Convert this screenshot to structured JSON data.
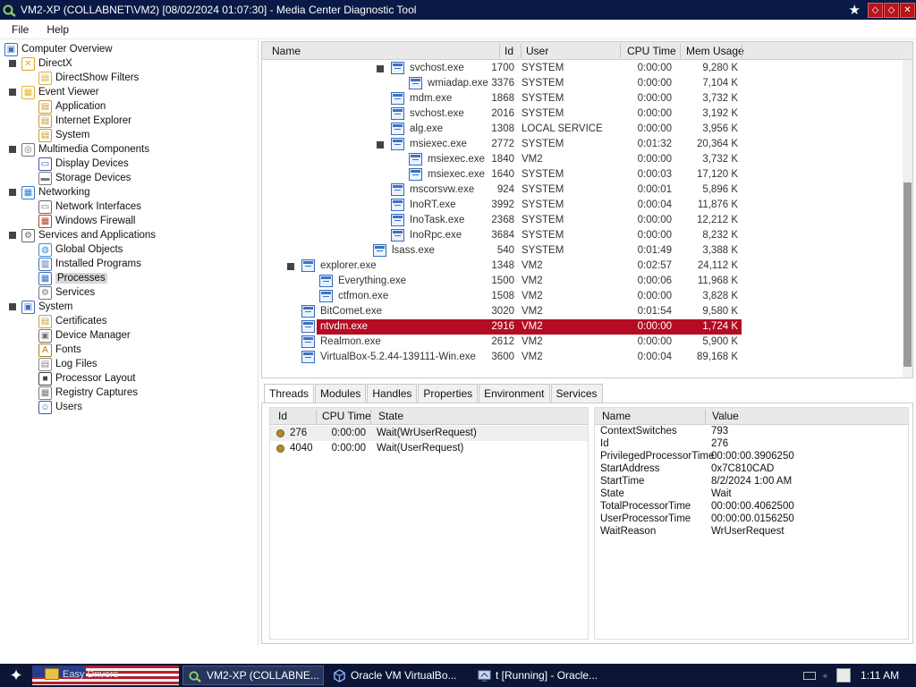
{
  "window": {
    "title": "VM2-XP (COLLABNET\\VM2) [08/02/2024 01:07:30] - Media Center Diagnostic Tool",
    "buttons": [
      "close-star",
      "restore",
      "minimize",
      "close"
    ]
  },
  "menu": [
    "File",
    "Help"
  ],
  "tree": [
    {
      "label": "Computer Overview",
      "level": 0,
      "icon": "computer-icon"
    },
    {
      "label": "DirectX",
      "level": 1,
      "icon": "directx-icon",
      "expander": true
    },
    {
      "label": "DirectShow Filters",
      "level": 2,
      "icon": "filter-icon"
    },
    {
      "label": "Event Viewer",
      "level": 1,
      "icon": "event-viewer-icon",
      "expander": true
    },
    {
      "label": "Application",
      "level": 2,
      "icon": "log-icon"
    },
    {
      "label": "Internet Explorer",
      "level": 2,
      "icon": "log-icon"
    },
    {
      "label": "System",
      "level": 2,
      "icon": "log-icon"
    },
    {
      "label": "Multimedia Components",
      "level": 1,
      "icon": "multimedia-icon",
      "expander": true
    },
    {
      "label": "Display Devices",
      "level": 2,
      "icon": "display-icon"
    },
    {
      "label": "Storage Devices",
      "level": 2,
      "icon": "storage-icon"
    },
    {
      "label": "Networking",
      "level": 1,
      "icon": "network-icon",
      "expander": true
    },
    {
      "label": "Network Interfaces",
      "level": 2,
      "icon": "nic-icon"
    },
    {
      "label": "Windows Firewall",
      "level": 2,
      "icon": "firewall-icon"
    },
    {
      "label": "Services and Applications",
      "level": 1,
      "icon": "services-apps-icon",
      "expander": true
    },
    {
      "label": "Global Objects",
      "level": 2,
      "icon": "globe-icon"
    },
    {
      "label": "Installed Programs",
      "level": 2,
      "icon": "programs-icon"
    },
    {
      "label": "Processes",
      "level": 2,
      "icon": "process-icon",
      "selected": true
    },
    {
      "label": "Services",
      "level": 2,
      "icon": "gear-icon"
    },
    {
      "label": "System",
      "level": 1,
      "icon": "system-icon",
      "expander": true
    },
    {
      "label": "Certificates",
      "level": 2,
      "icon": "certificate-icon"
    },
    {
      "label": "Device Manager",
      "level": 2,
      "icon": "device-manager-icon"
    },
    {
      "label": "Fonts",
      "level": 2,
      "icon": "fonts-icon"
    },
    {
      "label": "Log Files",
      "level": 2,
      "icon": "logfile-icon"
    },
    {
      "label": "Processor Layout",
      "level": 2,
      "icon": "processor-icon"
    },
    {
      "label": "Registry Captures",
      "level": 2,
      "icon": "registry-icon"
    },
    {
      "label": "Users",
      "level": 2,
      "icon": "users-icon"
    }
  ],
  "processes": {
    "columns": [
      "Name",
      "Id",
      "User",
      "CPU Time",
      "Mem Usage"
    ],
    "rows": [
      {
        "name": "svchost.exe",
        "id": "1700",
        "user": "SYSTEM",
        "cpu": "0:00:00",
        "mem": "9,280 K",
        "depth": 6,
        "expander": true
      },
      {
        "name": "wmiadap.exe",
        "id": "3376",
        "user": "SYSTEM",
        "cpu": "0:00:00",
        "mem": "7,104 K",
        "depth": 7
      },
      {
        "name": "mdm.exe",
        "id": "1868",
        "user": "SYSTEM",
        "cpu": "0:00:00",
        "mem": "3,732 K",
        "depth": 6
      },
      {
        "name": "svchost.exe",
        "id": "2016",
        "user": "SYSTEM",
        "cpu": "0:00:00",
        "mem": "3,192 K",
        "depth": 6
      },
      {
        "name": "alg.exe",
        "id": "1308",
        "user": "LOCAL SERVICE",
        "cpu": "0:00:00",
        "mem": "3,956 K",
        "depth": 6
      },
      {
        "name": "msiexec.exe",
        "id": "2772",
        "user": "SYSTEM",
        "cpu": "0:01:32",
        "mem": "20,364 K",
        "depth": 6,
        "expander": true
      },
      {
        "name": "msiexec.exe",
        "id": "1840",
        "user": "VM2",
        "cpu": "0:00:00",
        "mem": "3,732 K",
        "depth": 7
      },
      {
        "name": "msiexec.exe",
        "id": "1640",
        "user": "SYSTEM",
        "cpu": "0:00:03",
        "mem": "17,120 K",
        "depth": 7
      },
      {
        "name": "mscorsvw.exe",
        "id": "924",
        "user": "SYSTEM",
        "cpu": "0:00:01",
        "mem": "5,896 K",
        "depth": 6
      },
      {
        "name": "InoRT.exe",
        "id": "3992",
        "user": "SYSTEM",
        "cpu": "0:00:04",
        "mem": "11,876 K",
        "depth": 6
      },
      {
        "name": "InoTask.exe",
        "id": "2368",
        "user": "SYSTEM",
        "cpu": "0:00:00",
        "mem": "12,212 K",
        "depth": 6
      },
      {
        "name": "InoRpc.exe",
        "id": "3684",
        "user": "SYSTEM",
        "cpu": "0:00:00",
        "mem": "8,232 K",
        "depth": 6
      },
      {
        "name": "lsass.exe",
        "id": "540",
        "user": "SYSTEM",
        "cpu": "0:01:49",
        "mem": "3,388 K",
        "depth": 5
      },
      {
        "name": "explorer.exe",
        "id": "1348",
        "user": "VM2",
        "cpu": "0:02:57",
        "mem": "24,112 K",
        "depth": 1,
        "expander": true
      },
      {
        "name": "Everything.exe",
        "id": "1500",
        "user": "VM2",
        "cpu": "0:00:06",
        "mem": "11,968 K",
        "depth": 2
      },
      {
        "name": "ctfmon.exe",
        "id": "1508",
        "user": "VM2",
        "cpu": "0:00:00",
        "mem": "3,828 K",
        "depth": 2
      },
      {
        "name": "BitComet.exe",
        "id": "3020",
        "user": "VM2",
        "cpu": "0:01:54",
        "mem": "9,580 K",
        "depth": 1
      },
      {
        "name": "ntvdm.exe",
        "id": "2916",
        "user": "VM2",
        "cpu": "0:00:00",
        "mem": "1,724 K",
        "depth": 1,
        "selected": true
      },
      {
        "name": "Realmon.exe",
        "id": "2612",
        "user": "VM2",
        "cpu": "0:00:00",
        "mem": "5,900 K",
        "depth": 1
      },
      {
        "name": "VirtualBox-5.2.44-139111-Win.exe",
        "id": "3600",
        "user": "VM2",
        "cpu": "0:00:04",
        "mem": "89,168 K",
        "depth": 1
      }
    ]
  },
  "tabs": [
    "Threads",
    "Modules",
    "Handles",
    "Properties",
    "Environment",
    "Services"
  ],
  "active_tab": "Threads",
  "threads": {
    "columns": [
      "Id",
      "CPU Time",
      "State"
    ],
    "rows": [
      {
        "id": "276",
        "cpu": "0:00:00",
        "state": "Wait(WrUserRequest)",
        "selected": true
      },
      {
        "id": "4040",
        "cpu": "0:00:00",
        "state": "Wait(UserRequest)"
      }
    ]
  },
  "thread_props": {
    "columns": [
      "Name",
      "Value"
    ],
    "rows": [
      {
        "name": "ContextSwitches",
        "value": "793"
      },
      {
        "name": "Id",
        "value": "276"
      },
      {
        "name": "PrivilegedProcessorTime",
        "value": "00:00:00.3906250"
      },
      {
        "name": "StartAddress",
        "value": "0x7C810CAD"
      },
      {
        "name": "StartTime",
        "value": "8/2/2024 1:00 AM"
      },
      {
        "name": "State",
        "value": "Wait"
      },
      {
        "name": "TotalProcessorTime",
        "value": "00:00:00.4062500"
      },
      {
        "name": "UserProcessorTime",
        "value": "00:00:00.0156250"
      },
      {
        "name": "WaitReason",
        "value": "WrUserRequest"
      }
    ]
  },
  "taskbar": {
    "pinned_folder_label": "Easy Drivers",
    "buttons": [
      {
        "label": "VM2-XP (COLLABNE...",
        "icon": "diagnostic-tool-icon",
        "active": true
      },
      {
        "label": "Oracle VM VirtualBo...",
        "icon": "virtualbox-icon"
      },
      {
        "label": "t [Running] - Oracle...",
        "icon": "vm-running-icon"
      }
    ],
    "clock": "1:11 AM"
  },
  "colors": {
    "titlebar": "#0a1a47",
    "selection": "#b40c22",
    "taskbar": "#0c1535"
  }
}
